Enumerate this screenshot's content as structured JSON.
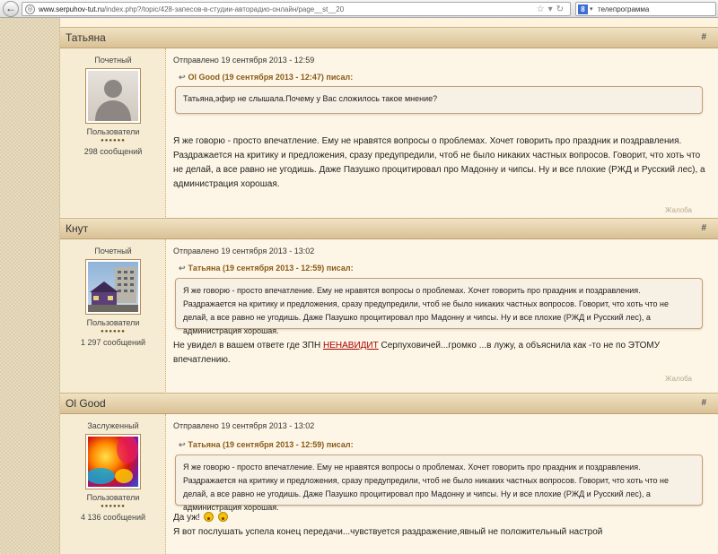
{
  "browser": {
    "url_host": "www.serpuhov-tut.ru",
    "url_path": "/index.php?/topic/428-запесов-в-студии-авторадио-онлайн/page__st__20",
    "search_text": "телепрограмма",
    "search_engine_icon": "google-icon"
  },
  "posts": [
    {
      "author": "Татьяна",
      "hash": "#",
      "rank": "Почетный",
      "role": "Пользователи",
      "pips": "●●●●●●",
      "count": "298 сообщений",
      "avatar": "silhouette-placeholder",
      "posted": "Отправлено 19 сентября 2013 - 12:59",
      "quote_author": "Ol Good (19 сентября 2013 - 12:47) писал:",
      "quote_text": "Татьяна,эфир не слышала.Почему у Вас сложилось такое мнение?",
      "body": "Я же говорю - просто впечатление. Ему не нравятся вопросы о проблемах. Хочет говорить про праздник и поздравления. Раздражается на критику и предложения, сразу предупредили, чтоб не было никаких частных вопросов. Говорит, что хоть что не делай, а все равно не угодишь. Даже Пазушко процитировал про Мадонну и чипсы. Ну и все плохие (РЖД и Русский лес), а администрация хорошая.",
      "report": "Жалоба"
    },
    {
      "author": "Кнут",
      "hash": "#",
      "rank": "Почетный",
      "role": "Пользователи",
      "pips": "●●●●●●",
      "count": "1 297 сообщений",
      "avatar": "building-photo",
      "posted": "Отправлено 19 сентября 2013 - 13:02",
      "quote_author": "Татьяна (19 сентября 2013 - 12:59) писал:",
      "quote_text": "Я же говорю - просто впечатление. Ему не нравятся вопросы о проблемах. Хочет говорить про праздник и поздравления. Раздражается на критику и предложения, сразу предупредили, чтоб не было никаких частных вопросов. Говорит, что хоть что не делай, а все равно не угодишь. Даже Пазушко процитировал про Мадонну и чипсы. Ну и все плохие (РЖД и Русский лес), а администрация хорошая.",
      "body_before": "Не увидел в вашем ответе где ЗПН ",
      "body_link": "НЕНАВИДИТ",
      "body_after": " Серпуховичей...громко ...в лужу, а объяснила как -то не по ЭТОМУ впечатлению.",
      "report": "Жалоба"
    },
    {
      "author": "Ol Good",
      "hash": "#",
      "rank": "Заслуженный",
      "role": "Пользователи",
      "pips": "●●●●●●",
      "count": "4 136 сообщений",
      "avatar": "colorful-abstract",
      "posted": "Отправлено 19 сентября 2013 - 13:02",
      "quote_author": "Татьяна (19 сентября 2013 - 12:59) писал:",
      "quote_text": "Я же говорю - просто впечатление. Ему не нравятся вопросы о проблемах. Хочет говорить про праздник и поздравления. Раздражается на критику и предложения, сразу предупредили, чтоб не было никаких частных вопросов. Говорит, что хоть что не делай, а все равно не угодишь. Даже Пазушко процитировал про Мадонну и чипсы. Ну и все плохие (РЖД и Русский лес), а администрация хорошая.",
      "body_line1": "Да уж!",
      "body_line2": "Я вот послушать успела конец передачи...чувствуется раздражение,явный не положительный настрой"
    }
  ]
}
